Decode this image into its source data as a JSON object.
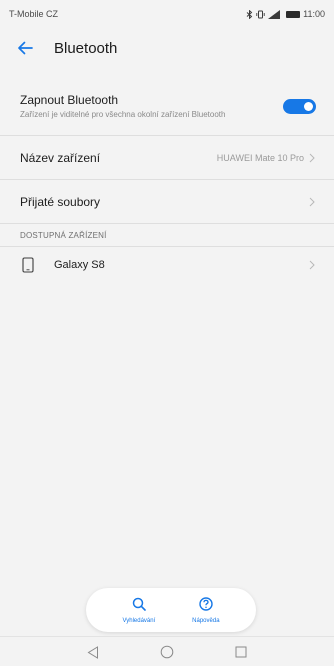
{
  "status_bar": {
    "carrier": "T-Mobile CZ",
    "time": "11:00",
    "icons": [
      "bluetooth-icon",
      "vibrate-icon",
      "signal-icon",
      "battery-icon"
    ]
  },
  "header": {
    "back_icon": "arrow-left-icon",
    "title": "Bluetooth"
  },
  "bluetooth_toggle": {
    "title": "Zapnout Bluetooth",
    "subtitle": "Zařízení je viditelné pro všechna okolní zařízení Bluetooth",
    "enabled": true,
    "accent_color": "#1778e6"
  },
  "settings": [
    {
      "label": "Název zařízení",
      "value": "HUAWEI Mate 10 Pro"
    },
    {
      "label": "Přijaté soubory",
      "value": ""
    }
  ],
  "available_devices": {
    "section_title": "DOSTUPNÁ ZAŘÍZENÍ",
    "devices": [
      {
        "icon": "phone-icon",
        "name": "Galaxy S8"
      }
    ]
  },
  "bottom_actions": [
    {
      "icon": "search-icon",
      "label": "Vyhledávání"
    },
    {
      "icon": "help-icon",
      "label": "Nápověda"
    }
  ],
  "nav_bar": [
    "back-triangle-icon",
    "home-circle-icon",
    "recents-square-icon"
  ]
}
